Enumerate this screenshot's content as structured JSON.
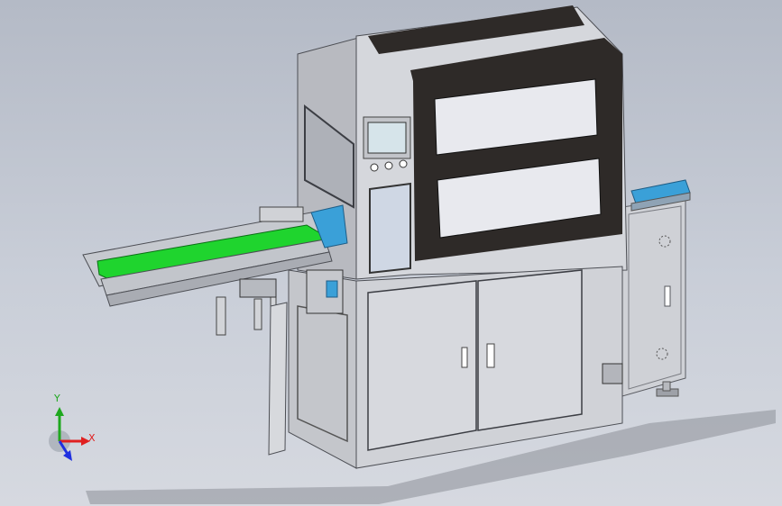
{
  "viewport": {
    "background": "#c4c9d3"
  },
  "machine": {
    "body_color": "#c9cbd0",
    "panel_dark": "#2e2a28",
    "conveyor_green": "#1fd42e",
    "rail_blue": "#3aa0d8"
  },
  "triad": {
    "x_label": "X",
    "y_label": "Y",
    "x_color": "#e02020",
    "y_color": "#1fa81f",
    "z_color": "#2030e0"
  }
}
